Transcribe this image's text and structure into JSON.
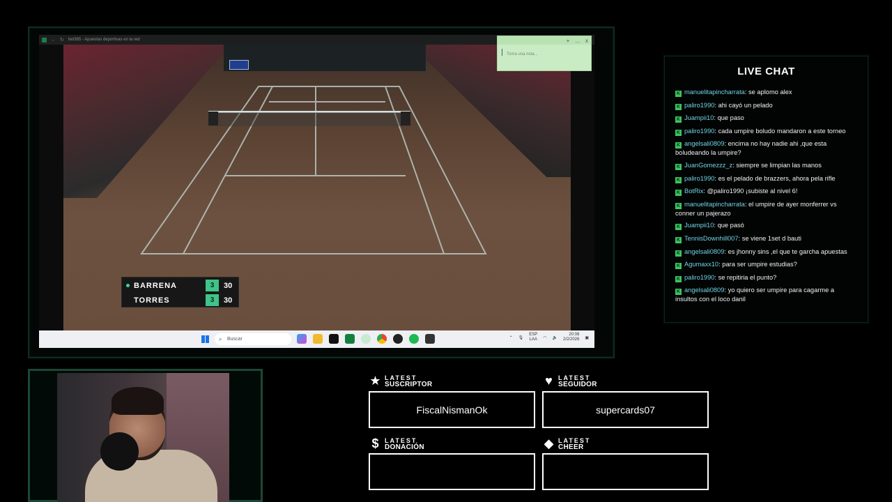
{
  "browser": {
    "tab_title": "bet365 - Apuestas deportivas en la red",
    "sticky_placeholder": "Toma una nota...",
    "sticky_controls": [
      "+",
      "...",
      "x"
    ]
  },
  "scoreboard": {
    "players": [
      {
        "name": "BARRENA",
        "sets": "3",
        "points": "30",
        "serving": true
      },
      {
        "name": "TORRES",
        "sets": "3",
        "points": "30",
        "serving": false
      }
    ]
  },
  "taskbar": {
    "search_placeholder": "Buscar",
    "lang_top": "ESP",
    "lang_bottom": "LAA",
    "time": "20:08",
    "date": "2/2/2026"
  },
  "chat": {
    "title": "LIVE CHAT",
    "badge_letter": "K",
    "messages": [
      {
        "user": "manuelitapincharrata",
        "text": "se aplomo alex"
      },
      {
        "user": "paliro1990",
        "text": "ahi cayó un pelado"
      },
      {
        "user": "Juampii10",
        "text": "que paso"
      },
      {
        "user": "paliro1990",
        "text": "cada umpire boludo mandaron a este torneo"
      },
      {
        "user": "angelsali0809",
        "text": "encima no hay nadie ahi ,que esta boludeando la umpire?"
      },
      {
        "user": "JuanGomezzz_z",
        "text": "siempre se limpian las manos"
      },
      {
        "user": "paliro1990",
        "text": "es el pelado de brazzers, ahora pela rifle"
      },
      {
        "user": "BotRix",
        "text": "@paliro1990 ¡subiste al nivel 6!"
      },
      {
        "user": "manuelitapincharrata",
        "text": "el umpire de ayer monferrer vs conner un pajerazo"
      },
      {
        "user": "Juampii10",
        "text": "que pasó"
      },
      {
        "user": "TennisDownhill007",
        "text": "se viene 1set d bauti"
      },
      {
        "user": "angelsali0809",
        "text": "es jhonny sins ,el que te garcha apuestas"
      },
      {
        "user": "Agumaxx10",
        "text": "para ser umpire estudias?"
      },
      {
        "user": "paliro1990",
        "text": "se repitiria el punto?"
      },
      {
        "user": "angelsali0809",
        "text": "yo quiero ser umpire para cagarme a insultos con el loco danil"
      }
    ]
  },
  "widgets": {
    "suscriptor": {
      "top": "LATEST",
      "bottom": "SUSCRIPTOR",
      "icon": "star-icon",
      "value": "FiscalNismanOk"
    },
    "seguidor": {
      "top": "LATEST",
      "bottom": "SEGUIDOR",
      "icon": "heart-icon",
      "value": "supercards07"
    },
    "donacion": {
      "top": "LATEST",
      "bottom": "DONACIÓN",
      "icon": "dollar-icon",
      "value": ""
    },
    "cheer": {
      "top": "LATEST",
      "bottom": "CHEER",
      "icon": "diamond-icon",
      "value": ""
    }
  }
}
